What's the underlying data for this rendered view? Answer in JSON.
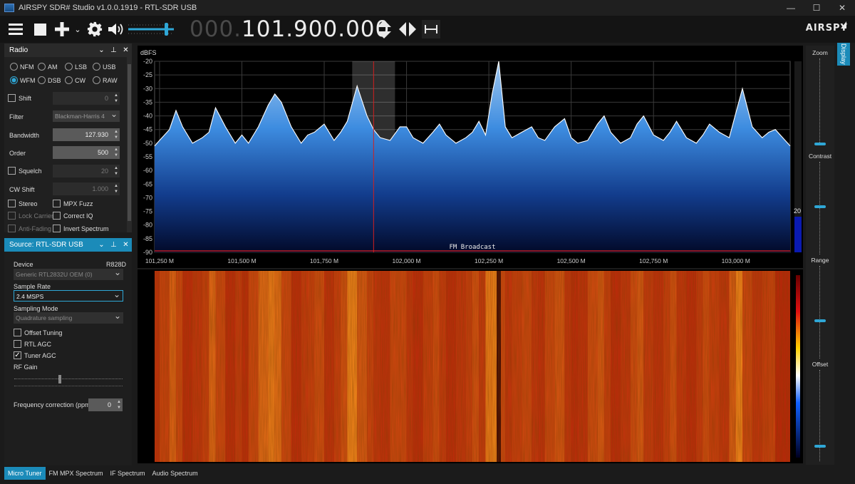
{
  "window": {
    "title": "AIRSPY SDR# Studio v1.0.0.1919 - RTL-SDR USB",
    "minimize": "—",
    "maximize": "☐",
    "close": "✕"
  },
  "toolbar": {
    "freq_dim": "000.",
    "freq_lit": "101.900.000",
    "logo": "AIRSPY",
    "volume_level": 0.85
  },
  "radio_panel": {
    "title": "Radio",
    "modes": [
      {
        "label": "NFM",
        "selected": false
      },
      {
        "label": "AM",
        "selected": false
      },
      {
        "label": "LSB",
        "selected": false
      },
      {
        "label": "USB",
        "selected": false
      },
      {
        "label": "WFM",
        "selected": true
      },
      {
        "label": "DSB",
        "selected": false
      },
      {
        "label": "CW",
        "selected": false
      },
      {
        "label": "RAW",
        "selected": false
      }
    ],
    "shift_label": "Shift",
    "shift_value": "0",
    "filter_label": "Filter",
    "filter_value": "Blackman-Harris 4",
    "bandwidth_label": "Bandwidth",
    "bandwidth_value": "127.930",
    "order_label": "Order",
    "order_value": "500",
    "squelch_label": "Squelch",
    "squelch_value": "20",
    "cwshift_label": "CW Shift",
    "cwshift_value": "1.000",
    "stereo": "Stereo",
    "mpx_fuzz": "MPX Fuzz",
    "lock_carrier": "Lock Carrier",
    "correct_iq": "Correct IQ",
    "anti_fading": "Anti-Fading",
    "invert_spectrum": "Invert Spectrum"
  },
  "source_panel": {
    "title": "Source: RTL-SDR USB",
    "device_label": "Device",
    "device_tuner": "R828D",
    "device_value": "Generic RTL2832U OEM (0)",
    "sample_rate_label": "Sample Rate",
    "sample_rate_value": "2.4 MSPS",
    "sampling_mode_label": "Sampling Mode",
    "sampling_mode_value": "Quadrature sampling",
    "offset_tuning": "Offset Tuning",
    "rtl_agc": "RTL AGC",
    "tuner_agc": "Tuner AGC",
    "rf_gain_label": "RF Gain",
    "freq_corr_label": "Frequency correction (ppm)",
    "freq_corr_value": "0"
  },
  "bottom_tabs": [
    "Micro Tuner",
    "FM MPX Spectrum",
    "IF Spectrum",
    "Audio Spectrum"
  ],
  "right_panel": {
    "zoom": "Zoom",
    "contrast": "Contrast",
    "range": "Range",
    "offset": "Offset",
    "display_tab": "Display",
    "level_value": "20"
  },
  "spectrum": {
    "ylabel": "dBFS",
    "y_ticks": [
      "-20",
      "-25",
      "-30",
      "-35",
      "-40",
      "-45",
      "-50",
      "-55",
      "-60",
      "-65",
      "-70",
      "-75",
      "-80",
      "-85",
      "-90"
    ],
    "x_ticks": [
      "101,250 M",
      "101,500 M",
      "101,750 M",
      "102,000 M",
      "102,250 M",
      "102,500 M",
      "102,750 M",
      "103,000 M"
    ],
    "band_label": "FM Broadcast"
  },
  "chart_data": {
    "type": "area",
    "xlabel": "",
    "ylabel": "dBFS",
    "xlim": [
      101.235,
      103.165
    ],
    "ylim": [
      -90,
      -20
    ],
    "selected_band": [
      101.835,
      101.965
    ],
    "center_frequency": 101.9,
    "x": [
      101.235,
      101.25,
      101.28,
      101.3,
      101.32,
      101.35,
      101.38,
      101.4,
      101.42,
      101.45,
      101.48,
      101.5,
      101.52,
      101.55,
      101.58,
      101.6,
      101.62,
      101.65,
      101.68,
      101.7,
      101.72,
      101.75,
      101.78,
      101.8,
      101.82,
      101.85,
      101.88,
      101.9,
      101.92,
      101.95,
      101.98,
      102.0,
      102.02,
      102.05,
      102.08,
      102.1,
      102.12,
      102.15,
      102.18,
      102.2,
      102.22,
      102.24,
      102.26,
      102.28,
      102.3,
      102.32,
      102.35,
      102.38,
      102.4,
      102.42,
      102.45,
      102.48,
      102.5,
      102.52,
      102.55,
      102.58,
      102.6,
      102.62,
      102.65,
      102.68,
      102.7,
      102.72,
      102.75,
      102.78,
      102.8,
      102.82,
      102.85,
      102.88,
      102.9,
      102.92,
      102.95,
      102.98,
      103.0,
      103.02,
      103.05,
      103.08,
      103.1,
      103.12,
      103.165
    ],
    "series": [
      {
        "values": [
          -51,
          -49,
          -45,
          -38,
          -44,
          -50,
          -48,
          -46,
          -37,
          -44,
          -50,
          -47,
          -50,
          -44,
          -36,
          -32,
          -35,
          -44,
          -50,
          -47,
          -46,
          -43,
          -49,
          -46,
          -42,
          -29,
          -40,
          -45,
          -48,
          -49,
          -44,
          -44,
          -48,
          -50,
          -46,
          -43,
          -47,
          -50,
          -48,
          -46,
          -42,
          -47,
          -32,
          -20,
          -44,
          -48,
          -46,
          -44,
          -48,
          -49,
          -44,
          -41,
          -48,
          -50,
          -49,
          -43,
          -40,
          -46,
          -50,
          -48,
          -43,
          -40,
          -47,
          -49,
          -46,
          -42,
          -48,
          -50,
          -47,
          -43,
          -46,
          -48,
          -39,
          -30,
          -44,
          -48,
          -46,
          -45,
          -51
        ]
      }
    ]
  }
}
